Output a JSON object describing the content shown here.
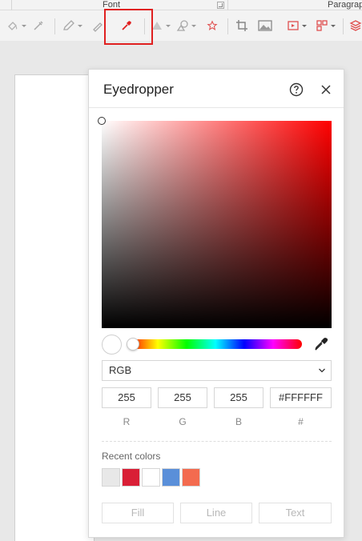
{
  "ribbon": {
    "font_group_label": "Font",
    "paragraph_group_label": "Paragrap"
  },
  "panel": {
    "title": "Eyedropper",
    "mode_selected": "RGB",
    "values": {
      "r": "255",
      "g": "255",
      "b": "255",
      "hex": "#FFFFFF"
    },
    "labels": {
      "r": "R",
      "g": "G",
      "b": "B",
      "hex": "#"
    },
    "recent_colors_label": "Recent colors",
    "recent_colors": [
      "#e8e8e8",
      "#d91f36",
      "#ffffff",
      "#5a8fd9",
      "#f36b4f"
    ],
    "current_color": "#FFFFFF",
    "hue_color": "#ff0000",
    "buttons": {
      "fill": "Fill",
      "line": "Line",
      "text": "Text"
    }
  }
}
